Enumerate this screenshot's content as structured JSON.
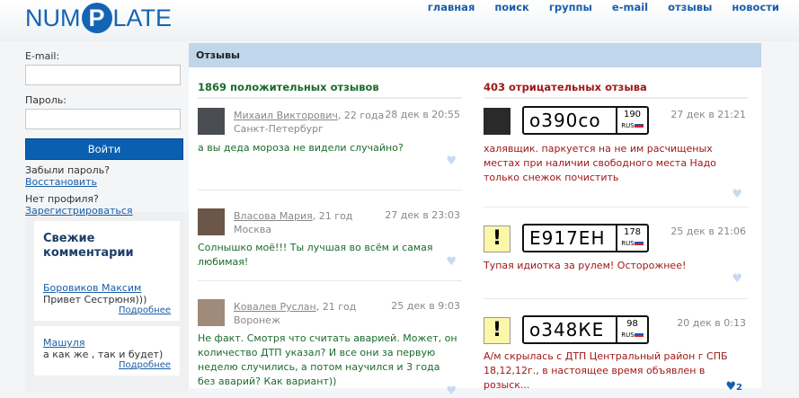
{
  "logo": {
    "text_left": "NUM",
    "text_p": "P",
    "text_right": "LATE"
  },
  "nav": [
    "главная",
    "поиск",
    "группы",
    "e-mail",
    "отзывы",
    "новости"
  ],
  "login": {
    "email_label": "E-mail:",
    "email_value": "",
    "password_label": "Пароль:",
    "password_value": "",
    "submit": "Войти",
    "forgot": "Забыли пароль?",
    "restore": "Восстановить",
    "no_profile": "Нет профиля?",
    "register": "Зарегистрироваться"
  },
  "fresh": {
    "title": "Свежие комментарии",
    "items": [
      {
        "author": "Боровиков Максим",
        "text": "Привет Сестрюня)))",
        "more": "Подробнее"
      },
      {
        "author": "Машуля",
        "text": "а как же , так и будет)",
        "more": "Подробнее"
      }
    ]
  },
  "main": {
    "title": "Отзывы",
    "positive": {
      "heading": "1869 положительных отзывов",
      "items": [
        {
          "name": "Михаил Викторович",
          "age": ", 22 года",
          "city": "Санкт-Петербург",
          "date": "28 дек в 20:55",
          "text": "а вы деда мороза не видели случайно?"
        },
        {
          "name": "Власова Мария",
          "age": ", 21 год",
          "city": "Москва",
          "date": "27 дек в 23:03",
          "text": "Солнышко моё!!! Ты лучшая во всём и самая любимая!"
        },
        {
          "name": "Ковалев Руслан",
          "age": ", 21 год",
          "city": "Воронеж",
          "date": "25 дек в 9:03",
          "text": "Не факт. Смотря что считать аварией. Может, он количество ДТП указал? И все они за первую неделю случились, а потом научился и 3 года без аварий? Как вариант))"
        }
      ]
    },
    "negative": {
      "heading": "403 отрицательных отзыва",
      "items": [
        {
          "plate": "о390со",
          "region": "190",
          "country": "RUS",
          "date": "27 дек в 21:21",
          "text": "халявщик. паркуется на не им расчищеных местах при наличии свободного места Надо только снежок почистить",
          "likes": ""
        },
        {
          "plate": "Е917ЕН",
          "region": "178",
          "country": "RUS",
          "date": "25 дек в 21:06",
          "text": "Тупая идиотка за рулем! Осторожнее!",
          "likes": ""
        },
        {
          "plate": "о348КЕ",
          "region": "98",
          "country": "RUS",
          "date": "20 дек в 0:13",
          "text": "А/м скрылась с ДТП Центральный район г СПБ 18,12,12г., в настоящее время объявлен в розыск...",
          "likes": "2"
        }
      ]
    }
  },
  "colors": {
    "positive": "#1a6b2b",
    "negative": "#a01818",
    "accent": "#0a5fb0"
  }
}
